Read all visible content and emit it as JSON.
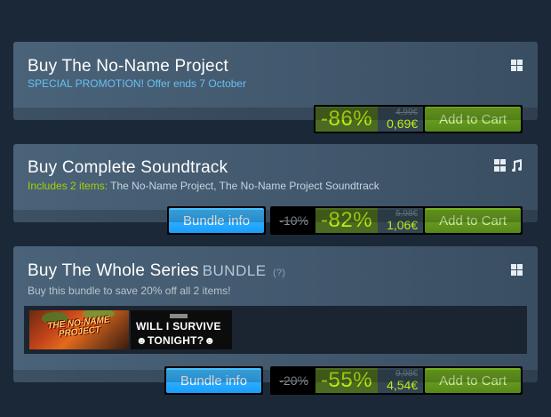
{
  "cards": [
    {
      "title": "Buy The No-Name Project",
      "subtitle": "SPECIAL PROMOTION! Offer ends 7 October",
      "platforms": [
        "windows-icon"
      ],
      "discount": "-86%",
      "original_price": "4,99€",
      "final_price": "0,69€",
      "cart_label": "Add to Cart"
    },
    {
      "title": "Buy Complete Soundtrack",
      "subtitle_prefix": "Includes 2 items:",
      "subtitle_items": "The No-Name Project, The No-Name Project Soundtrack",
      "platforms": [
        "windows-icon",
        "music-icon"
      ],
      "bundle_info_label": "Bundle info",
      "bundle_discount": "-10%",
      "discount": "-82%",
      "original_price": "5,98€",
      "final_price": "1,06€",
      "cart_label": "Add to Cart"
    },
    {
      "title": "Buy The Whole Series",
      "title_tag": "BUNDLE",
      "help": "(?)",
      "subtitle": "Buy this bundle to save 20% off all 2 items!",
      "platforms": [
        "windows-icon"
      ],
      "items": [
        {
          "name": "THE NO-NAME PROJECT",
          "icon": "game-capsule-no-name-project"
        },
        {
          "name_line1": "WILL I SURVIVE",
          "name_line2": "TONIGHT?",
          "icon": "game-capsule-will-i-survive-tonight"
        }
      ],
      "bundle_info_label": "Bundle info",
      "bundle_discount": "-20%",
      "discount": "-55%",
      "original_price": "9,98€",
      "final_price": "4,54€",
      "cart_label": "Add to Cart"
    }
  ],
  "colors": {
    "background": "#1b2838",
    "discount_green": "#beee11",
    "link_blue": "#66c0f4",
    "cart_green": "#75b022",
    "info_blue": "#1a9fff"
  }
}
